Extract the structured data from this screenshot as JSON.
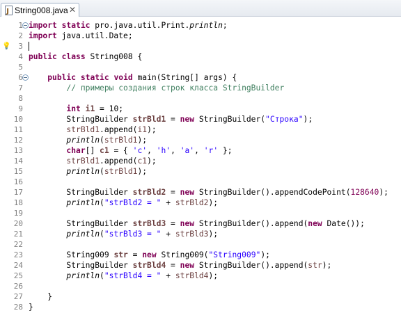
{
  "tab": {
    "title": "String008.java",
    "close": "✕"
  },
  "lines": [
    {
      "n": "1",
      "fold": true,
      "tokens": [
        [
          "kw",
          "import"
        ],
        [
          "",
          " "
        ],
        [
          "kw",
          "static"
        ],
        [
          "",
          " pro.java.util.Print."
        ],
        [
          "ital",
          "println"
        ],
        [
          "",
          ";"
        ]
      ]
    },
    {
      "n": "2",
      "fold": false,
      "tokens": [
        [
          "kw",
          "import"
        ],
        [
          "",
          " java.util.Date;"
        ]
      ]
    },
    {
      "n": "3",
      "fold": false,
      "cursor": true,
      "bulb": true,
      "tokens": []
    },
    {
      "n": "4",
      "fold": false,
      "tokens": [
        [
          "kw",
          "public"
        ],
        [
          "",
          " "
        ],
        [
          "kw",
          "class"
        ],
        [
          "",
          " String008 {"
        ]
      ]
    },
    {
      "n": "5",
      "fold": false,
      "tokens": []
    },
    {
      "n": "6",
      "fold": true,
      "tokens": [
        [
          "",
          "    "
        ],
        [
          "kw",
          "public"
        ],
        [
          "",
          " "
        ],
        [
          "kw",
          "static"
        ],
        [
          "",
          " "
        ],
        [
          "kw",
          "void"
        ],
        [
          "",
          " main(String[] args) {"
        ]
      ]
    },
    {
      "n": "7",
      "fold": false,
      "tokens": [
        [
          "",
          "        "
        ],
        [
          "cmt",
          "// примеры создания строк класса StringBuilder"
        ]
      ]
    },
    {
      "n": "8",
      "fold": false,
      "tokens": []
    },
    {
      "n": "9",
      "fold": false,
      "tokens": [
        [
          "",
          "        "
        ],
        [
          "kw",
          "int"
        ],
        [
          "",
          " "
        ],
        [
          "var",
          "i1"
        ],
        [
          "",
          " = 10;"
        ]
      ]
    },
    {
      "n": "10",
      "fold": false,
      "tokens": [
        [
          "",
          "        StringBuilder "
        ],
        [
          "var",
          "strBld1"
        ],
        [
          "",
          " = "
        ],
        [
          "kw",
          "new"
        ],
        [
          "",
          " StringBuilder("
        ],
        [
          "str",
          "\"Строка\""
        ],
        [
          "",
          ");"
        ]
      ]
    },
    {
      "n": "11",
      "fold": false,
      "tokens": [
        [
          "",
          "        "
        ],
        [
          "var2",
          "strBld1"
        ],
        [
          "",
          ".append("
        ],
        [
          "var2",
          "i1"
        ],
        [
          "",
          ");"
        ]
      ]
    },
    {
      "n": "12",
      "fold": false,
      "tokens": [
        [
          "",
          "        "
        ],
        [
          "ital",
          "println"
        ],
        [
          "",
          "("
        ],
        [
          "var2",
          "strBld1"
        ],
        [
          "",
          ");"
        ]
      ]
    },
    {
      "n": "13",
      "fold": false,
      "tokens": [
        [
          "",
          "        "
        ],
        [
          "kw",
          "char"
        ],
        [
          "",
          "[] "
        ],
        [
          "var",
          "c1"
        ],
        [
          "",
          " = { "
        ],
        [
          "str",
          "'c'"
        ],
        [
          "",
          ", "
        ],
        [
          "str",
          "'h'"
        ],
        [
          "",
          ", "
        ],
        [
          "str",
          "'a'"
        ],
        [
          "",
          ", "
        ],
        [
          "str",
          "'r'"
        ],
        [
          "",
          " };"
        ]
      ]
    },
    {
      "n": "14",
      "fold": false,
      "tokens": [
        [
          "",
          "        "
        ],
        [
          "var2",
          "strBld1"
        ],
        [
          "",
          ".append("
        ],
        [
          "var2",
          "c1"
        ],
        [
          "",
          ");"
        ]
      ]
    },
    {
      "n": "15",
      "fold": false,
      "tokens": [
        [
          "",
          "        "
        ],
        [
          "ital",
          "println"
        ],
        [
          "",
          "("
        ],
        [
          "var2",
          "strBld1"
        ],
        [
          "",
          ");"
        ]
      ]
    },
    {
      "n": "16",
      "fold": false,
      "tokens": []
    },
    {
      "n": "17",
      "fold": false,
      "tokens": [
        [
          "",
          "        StringBuilder "
        ],
        [
          "var",
          "strBld2"
        ],
        [
          "",
          " = "
        ],
        [
          "kw",
          "new"
        ],
        [
          "",
          " StringBuilder().appendCodePoint("
        ],
        [
          "fld",
          "128640"
        ],
        [
          "",
          ");"
        ]
      ]
    },
    {
      "n": "18",
      "fold": false,
      "tokens": [
        [
          "",
          "        "
        ],
        [
          "ital",
          "println"
        ],
        [
          "",
          "("
        ],
        [
          "str",
          "\"strBld2 = \""
        ],
        [
          "",
          " + "
        ],
        [
          "var2",
          "strBld2"
        ],
        [
          "",
          ");"
        ]
      ]
    },
    {
      "n": "19",
      "fold": false,
      "tokens": []
    },
    {
      "n": "20",
      "fold": false,
      "tokens": [
        [
          "",
          "        StringBuilder "
        ],
        [
          "var",
          "strBld3"
        ],
        [
          "",
          " = "
        ],
        [
          "kw",
          "new"
        ],
        [
          "",
          " StringBuilder().append("
        ],
        [
          "kw",
          "new"
        ],
        [
          "",
          " Date());"
        ]
      ]
    },
    {
      "n": "21",
      "fold": false,
      "tokens": [
        [
          "",
          "        "
        ],
        [
          "ital",
          "println"
        ],
        [
          "",
          "("
        ],
        [
          "str",
          "\"strBld3 = \""
        ],
        [
          "",
          " + "
        ],
        [
          "var2",
          "strBld3"
        ],
        [
          "",
          ");"
        ]
      ]
    },
    {
      "n": "22",
      "fold": false,
      "tokens": []
    },
    {
      "n": "23",
      "fold": false,
      "tokens": [
        [
          "",
          "        String009 "
        ],
        [
          "var",
          "str"
        ],
        [
          "",
          " = "
        ],
        [
          "kw",
          "new"
        ],
        [
          "",
          " String009("
        ],
        [
          "str",
          "\"String009\""
        ],
        [
          "",
          ");"
        ]
      ]
    },
    {
      "n": "24",
      "fold": false,
      "tokens": [
        [
          "",
          "        StringBuilder "
        ],
        [
          "var",
          "strBld4"
        ],
        [
          "",
          " = "
        ],
        [
          "kw",
          "new"
        ],
        [
          "",
          " StringBuilder().append("
        ],
        [
          "var2",
          "str"
        ],
        [
          "",
          ");"
        ]
      ]
    },
    {
      "n": "25",
      "fold": false,
      "tokens": [
        [
          "",
          "        "
        ],
        [
          "ital",
          "println"
        ],
        [
          "",
          "("
        ],
        [
          "str",
          "\"strBld4 = \""
        ],
        [
          "",
          " + "
        ],
        [
          "var2",
          "strBld4"
        ],
        [
          "",
          ");"
        ]
      ]
    },
    {
      "n": "26",
      "fold": false,
      "tokens": []
    },
    {
      "n": "27",
      "fold": false,
      "tokens": [
        [
          "",
          "    }"
        ]
      ]
    },
    {
      "n": "28",
      "fold": false,
      "tokens": [
        [
          "",
          "}"
        ]
      ]
    }
  ]
}
